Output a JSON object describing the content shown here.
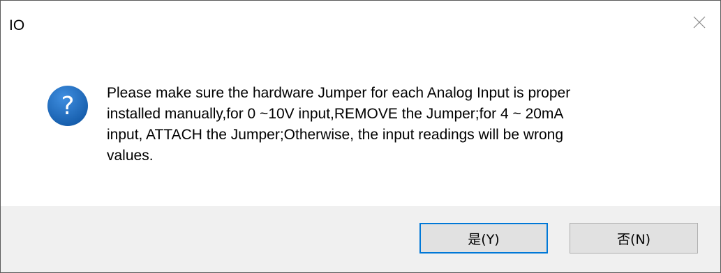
{
  "window": {
    "title": "IO",
    "close_icon": "close-icon"
  },
  "dialog": {
    "icon": "question-icon",
    "icon_color": "#1e6fc4",
    "message": "Please make sure the hardware Jumper for each Analog Input is proper\ninstalled manually,for 0 ~10V input,REMOVE the Jumper;for 4 ~ 20mA\ninput, ATTACH the Jumper;Otherwise, the input readings will be wrong\nvalues."
  },
  "buttons": {
    "yes_label": "是(Y)",
    "no_label": "否(N)",
    "default_border_color": "#0078d7"
  }
}
